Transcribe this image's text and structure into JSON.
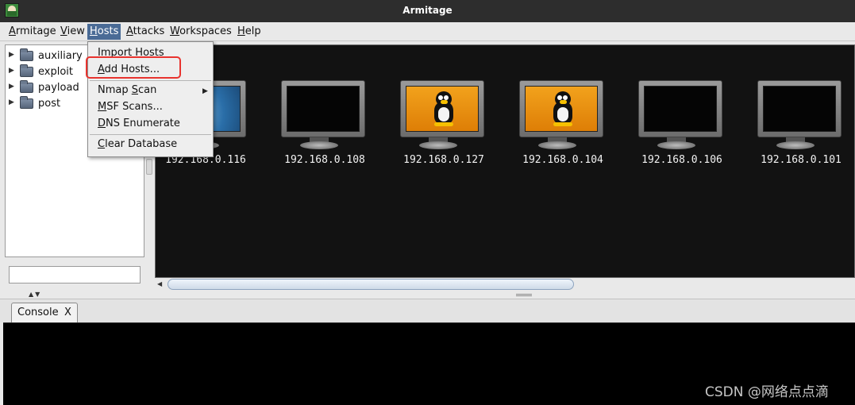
{
  "window": {
    "title": "Armitage"
  },
  "menubar": {
    "items": [
      {
        "label": "Armitage",
        "u": "A",
        "rest": "rmitage"
      },
      {
        "label": "View",
        "u": "V",
        "rest": "iew"
      },
      {
        "label": "Hosts",
        "u": "H",
        "rest": "osts"
      },
      {
        "label": "Attacks",
        "u": "A",
        "rest": "ttacks"
      },
      {
        "label": "Workspaces",
        "u": "W",
        "rest": "orkspaces"
      },
      {
        "label": "Help",
        "u": "H",
        "rest": "elp"
      }
    ],
    "active": "Hosts"
  },
  "hosts_menu": {
    "items": [
      {
        "label": "Import Hosts",
        "pre": "",
        "u": "I",
        "rest": "mport Hosts"
      },
      {
        "label": "Add Hosts...",
        "pre": "",
        "u": "A",
        "rest": "dd Hosts..."
      },
      {
        "label": "Nmap Scan",
        "pre": "Nmap ",
        "u": "S",
        "rest": "can",
        "submenu_arrow": "▶"
      },
      {
        "label": "MSF Scans...",
        "pre": "",
        "u": "M",
        "rest": "SF Scans..."
      },
      {
        "label": "DNS Enumerate",
        "pre": "",
        "u": "D",
        "rest": "NS Enumerate"
      },
      {
        "label": "Clear Database",
        "pre": "",
        "u": "C",
        "rest": "lear Database"
      }
    ],
    "highlighted": "Add Hosts...",
    "highlight_color": "#e8332e"
  },
  "module_tree": {
    "items": [
      {
        "label": "auxiliary",
        "arrow": "▶",
        "icon": "folder-icon"
      },
      {
        "label": "exploit",
        "arrow": "▶",
        "icon": "folder-icon"
      },
      {
        "label": "payload",
        "arrow": "▶",
        "icon": "folder-icon"
      },
      {
        "label": "post",
        "arrow": "▶",
        "icon": "folder-icon"
      }
    ]
  },
  "search": {
    "value": ""
  },
  "targets": {
    "hosts": [
      {
        "ip": "192.168.0.116",
        "os": "windows",
        "icon": "windows-monitor-icon"
      },
      {
        "ip": "192.168.0.108",
        "os": "unknown",
        "icon": "monitor-icon"
      },
      {
        "ip": "192.168.0.127",
        "os": "linux",
        "icon": "linux-monitor-icon"
      },
      {
        "ip": "192.168.0.104",
        "os": "linux",
        "icon": "linux-monitor-icon"
      },
      {
        "ip": "192.168.0.106",
        "os": "unknown",
        "icon": "monitor-icon"
      },
      {
        "ip": "192.168.0.101",
        "os": "unknown",
        "icon": "monitor-icon"
      }
    ]
  },
  "console_tab": {
    "label": "Console",
    "close": "X"
  },
  "watermark": "CSDN @网络点点滴",
  "colors": {
    "titlebar": "#2d2d2d",
    "menu_active": "#4a6b96",
    "linux_screen": "#ef9412",
    "targets_bg": "#121212"
  }
}
